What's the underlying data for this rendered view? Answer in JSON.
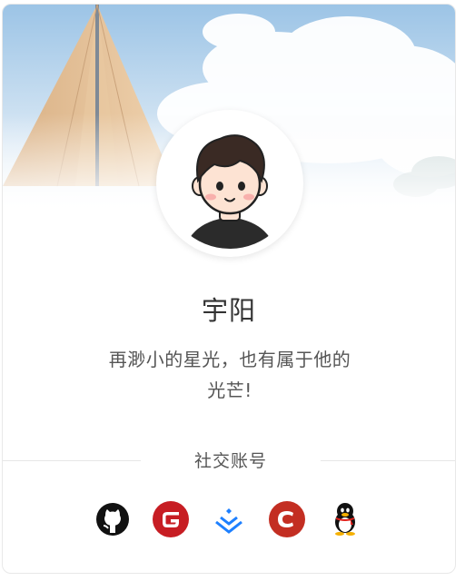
{
  "profile": {
    "name": "宇阳",
    "bio_line1": "再渺小的星光，也有属于他的",
    "bio_line2": "光芒!"
  },
  "social": {
    "title": "社交账号",
    "icons": [
      "github-icon",
      "gitee-icon",
      "juejin-icon",
      "csdn-icon",
      "qq-icon"
    ]
  },
  "colors": {
    "gitee": "#c71d23",
    "csdn": "#c32e22",
    "juejin": "#1e80ff",
    "github": "#111111"
  }
}
